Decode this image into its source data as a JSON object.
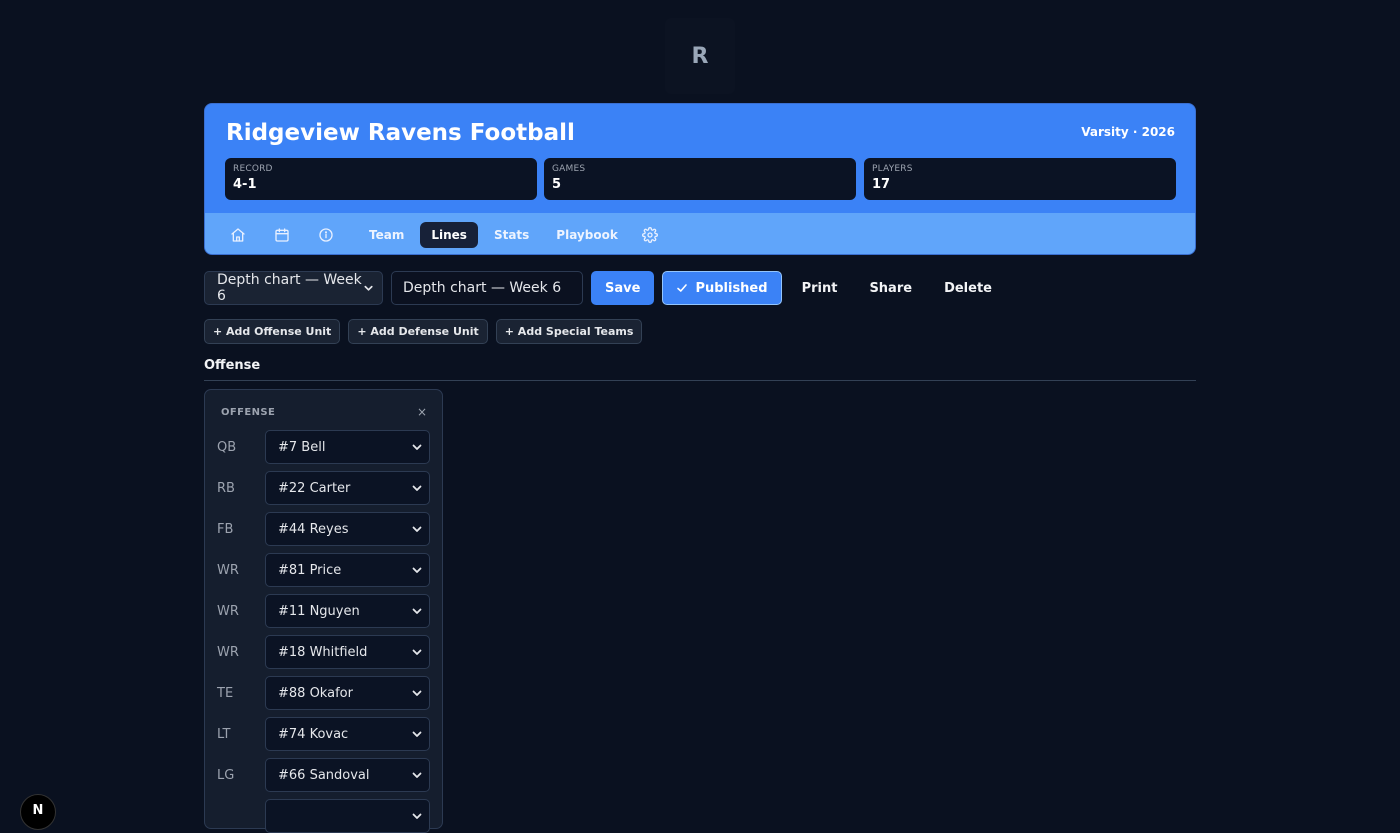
{
  "logo": {
    "letter": "R"
  },
  "header": {
    "team_name": "Ridgeview Ravens Football",
    "season": "Varsity · 2026",
    "stats": [
      {
        "label": "RECORD",
        "value": "4-1"
      },
      {
        "label": "GAMES",
        "value": "5"
      },
      {
        "label": "PLAYERS",
        "value": "17"
      }
    ],
    "nav": {
      "icons": [
        "home-icon",
        "calendar-icon",
        "info-icon"
      ],
      "tabs": [
        "Team",
        "Lines",
        "Stats",
        "Playbook"
      ],
      "active_tab": "Lines",
      "settings_icon": "gear-icon"
    }
  },
  "toolbar": {
    "chart_select": "Depth chart — Week 6",
    "chart_name_value": "Depth chart — Week 6",
    "save_label": "Save",
    "published_label": "Published",
    "print_label": "Print",
    "share_label": "Share",
    "delete_label": "Delete"
  },
  "add_buttons": {
    "offense": "+ Add Offense Unit",
    "defense": "+ Add Defense Unit",
    "special": "+ Add Special Teams"
  },
  "section": {
    "title": "Offense"
  },
  "unit": {
    "title": "OFFENSE",
    "close": "×",
    "positions": [
      {
        "pos": "QB",
        "player": "#7 Bell"
      },
      {
        "pos": "RB",
        "player": "#22 Carter"
      },
      {
        "pos": "FB",
        "player": "#44 Reyes"
      },
      {
        "pos": "WR",
        "player": "#81 Price"
      },
      {
        "pos": "WR",
        "player": "#11 Nguyen"
      },
      {
        "pos": "WR",
        "player": "#18 Whitfield"
      },
      {
        "pos": "TE",
        "player": "#88 Okafor"
      },
      {
        "pos": "LT",
        "player": "#74 Kovac"
      },
      {
        "pos": "LG",
        "player": "#66 Sandoval"
      },
      {
        "pos": "",
        "player": ""
      }
    ]
  },
  "corner_badge": {
    "letter": "N"
  },
  "colors": {
    "background": "#0a1120",
    "header_blue": "#3b82f6",
    "nav_blue": "#60a5fa",
    "active_tab": "#172138"
  }
}
